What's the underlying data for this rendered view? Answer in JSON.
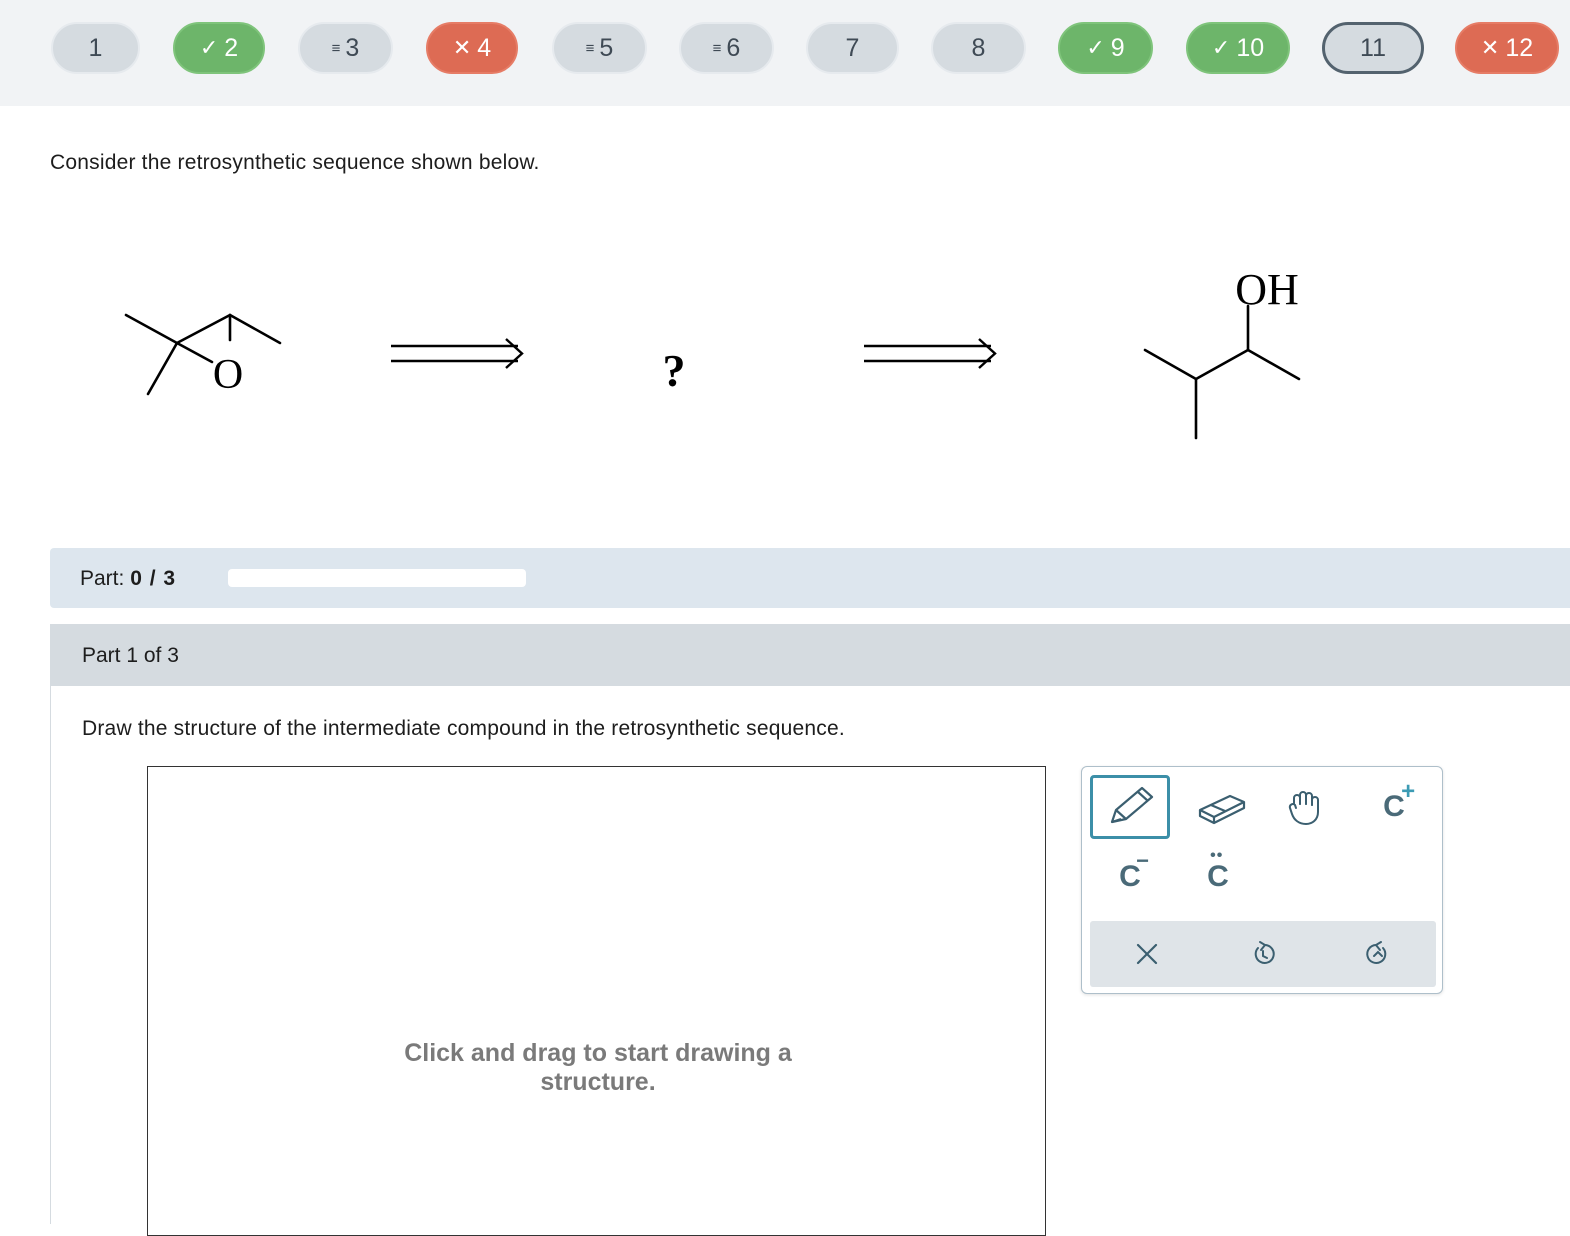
{
  "nav": {
    "questions": [
      {
        "label": "1",
        "status": "neutral",
        "mark": ""
      },
      {
        "label": "2",
        "status": "correct",
        "mark": "✓"
      },
      {
        "label": "3",
        "status": "neutral",
        "mark": "≡"
      },
      {
        "label": "4",
        "status": "wrong",
        "mark": "✕"
      },
      {
        "label": "5",
        "status": "neutral",
        "mark": "≡"
      },
      {
        "label": "6",
        "status": "neutral",
        "mark": "≡"
      },
      {
        "label": "7",
        "status": "neutral",
        "mark": ""
      },
      {
        "label": "8",
        "status": "neutral",
        "mark": ""
      },
      {
        "label": "9",
        "status": "correct",
        "mark": "✓"
      },
      {
        "label": "10",
        "status": "correct",
        "mark": "✓"
      },
      {
        "label": "11",
        "status": "current",
        "mark": ""
      },
      {
        "label": "12",
        "status": "wrong",
        "mark": "✕"
      }
    ]
  },
  "question": {
    "prompt": "Consider the retrosynthetic sequence shown below.",
    "scheme": {
      "start_heteroatom": "O",
      "unknown": "?",
      "product_group": "OH"
    }
  },
  "parts": {
    "label": "Part:",
    "current": "0 / 3",
    "progress_fraction": 0,
    "header": "Part 1 of 3",
    "instruction": "Draw the structure of the intermediate compound in the retrosynthetic sequence."
  },
  "canvas": {
    "hint": "Click and drag to start drawing a structure."
  },
  "tools": {
    "items": [
      "pencil-icon",
      "eraser-icon",
      "hand-icon",
      "carbocation-icon",
      "carbanion-icon",
      "lone-pair-carbon-icon"
    ],
    "actions": [
      "clear-icon",
      "undo-icon",
      "redo-icon"
    ],
    "chem_letter": "C",
    "plus": "+",
    "minus": "−",
    "dots": "••"
  },
  "colors": {
    "correct": "#6db56a",
    "wrong": "#dd6b54",
    "neutral": "#d5dbe0",
    "selected_tool": "#3c8fa8"
  }
}
